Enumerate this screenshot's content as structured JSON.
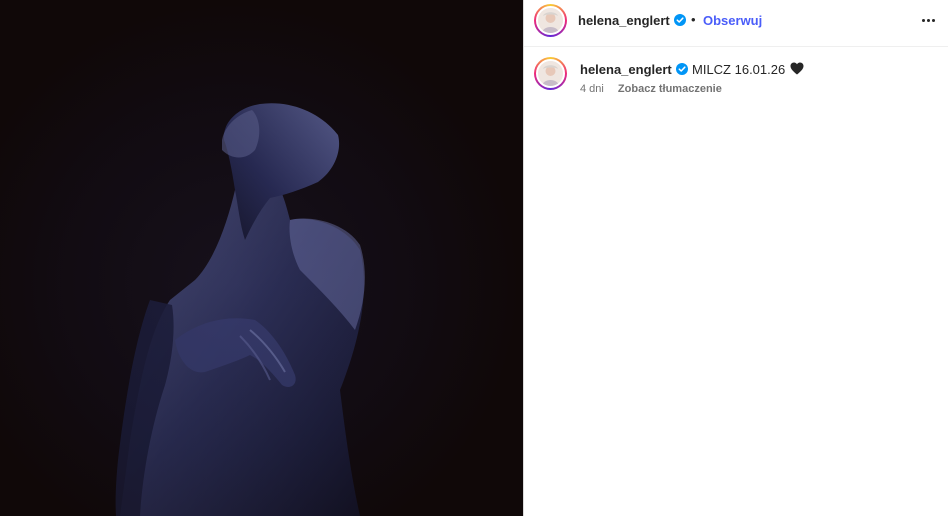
{
  "post": {
    "author": {
      "username": "helena_englert",
      "verified": true,
      "avatar_icon": "avatar-image"
    },
    "follow_separator": "•",
    "follow_label": "Obserwuj",
    "more_options_icon": "more-horizontal-icon",
    "image_alt": "dark artistic portrait photo",
    "caption": {
      "username": "helena_englert",
      "text": "MILCZ 16.01.26",
      "emoji_icon": "black-heart-icon",
      "time_ago": "4 dni",
      "translate_label": "Zobacz tłumaczenie"
    }
  },
  "colors": {
    "accent": "#4a5df9",
    "verified": "#0095f6",
    "text": "#262626",
    "muted": "#737373",
    "photo_bg": "#100808"
  }
}
